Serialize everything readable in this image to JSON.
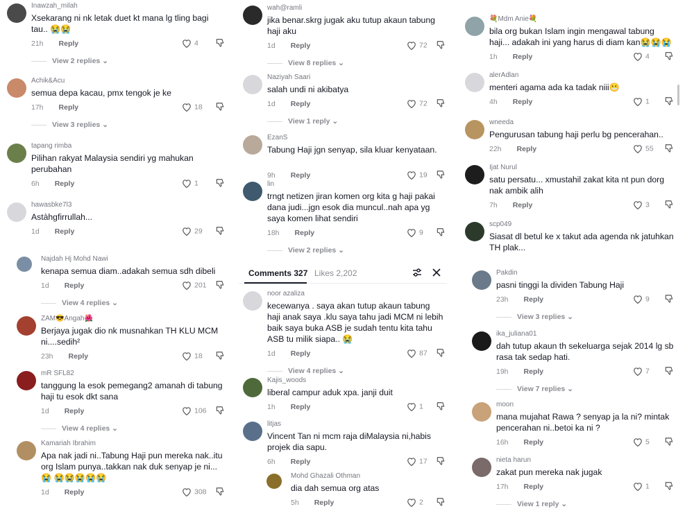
{
  "sheet": {
    "tab_comments": "Comments 327",
    "tab_likes": "Likes 2,202"
  },
  "reply_label": "Reply",
  "colors": {
    "text": "#161823",
    "meta": "#8a8b91",
    "background": "#ffffff"
  },
  "panel1": [
    {
      "user": "Inawzah_milah",
      "text": "Xsekarang ni nk letak duet kt mana lg tling bagi tau.. 😭😭",
      "time": "21h",
      "likes": "4",
      "replies": "View 2 replies",
      "avatar": "#4a4a4a"
    },
    {
      "user": "Achik&Acu",
      "text": "semua depa kacau, pmx tengok je ke",
      "time": "17h",
      "likes": "18",
      "replies": "View 3 replies",
      "avatar": "#c98a6a"
    },
    {
      "user": "tapang rimba",
      "text": "Pilihan rakyat Malaysia sendiri yg mahukan perubahan",
      "time": "6h",
      "likes": "1",
      "replies": "",
      "avatar": "#6b7f4a"
    },
    {
      "user": "hawasbke7l3",
      "text": "Astàhgfirrullah...",
      "time": "1d",
      "likes": "29",
      "replies": "",
      "avatar": "#d8d8dc"
    },
    {
      "user": "Najdah Hj Mohd Nawi",
      "text": "kenapa semua diam..adakah semua sdh dibeli",
      "time": "1d",
      "likes": "201",
      "replies": "View 4 replies",
      "avatar": "#7a8fa5"
    },
    {
      "user": "ZAM😎Angah🌺",
      "text": "Berjaya jugak dio nk musnahkan TH KLU MCM ni....sedih²",
      "time": "23h",
      "likes": "18",
      "replies": "",
      "avatar": "#a3402f"
    },
    {
      "user": "mR SFL82",
      "text": "tanggung la esok pemegang2 amanah di tabung haji tu esok dkt sana",
      "time": "1d",
      "likes": "106",
      "replies": "View 4 replies",
      "avatar": "#8a1e1e"
    },
    {
      "user": "Kamariah Ibrahim",
      "text": "Apa nak jadi ni..Tabung Haji pun mereka nak..itu org Islam punya..takkan nak duk senyap je ni...😭 😭😭😭😭😭",
      "time": "1d",
      "likes": "308",
      "replies": "",
      "avatar": "#b28f63"
    }
  ],
  "panel2": [
    {
      "user": "wah@ramli",
      "text": "jika benar.skrg jugak aku tutup akaun tabung haji aku",
      "time": "1d",
      "likes": "72",
      "replies": "View 8 replies",
      "avatar": "#2a2a2a"
    },
    {
      "user": "Naziyah Saari",
      "text": "salah undi ni akibatya",
      "time": "1d",
      "likes": "72",
      "replies": "View 1 reply",
      "avatar": "#d8d8dc"
    },
    {
      "user": "EzanS",
      "text": "Tabung Haji jgn senyap, sila kluar kenyataan.",
      "time": "9h",
      "likes": "19",
      "replies": "",
      "avatar": "#b9a99a"
    },
    {
      "user": "lin",
      "text": "trngt netizen jiran komen org kita g haji pakai dana judi...jgn esok dia muncul..nah apa yg saya komen lihat sendiri",
      "time": "18h",
      "likes": "9",
      "replies": "View 2 replies",
      "avatar": "#3f5a6e"
    },
    {
      "user": "noor azaliza",
      "text": "kecewanya . saya akan tutup akaun tabung haji anak saya .klu saya tahu jadi MCM ni lebih baik saya buka ASB je sudah tentu kita tahu ASB tu milik siapa.. 😭",
      "time": "1d",
      "likes": "87",
      "replies": "View 4 replies",
      "avatar": "#d8d8dc"
    },
    {
      "user": "Kajis_woods",
      "text": "liberal campur aduk xpa. janji duit",
      "time": "1h",
      "likes": "1",
      "replies": "",
      "avatar": "#4f6a3a"
    },
    {
      "user": "litjas",
      "text": "Vincent Tan ni mcm raja diMalaysia ni,habis projek dia sapu.",
      "time": "6h",
      "likes": "17",
      "replies": "",
      "avatar": "#5a6f8a"
    },
    {
      "user": "Mohd Ghazali Othman",
      "text": "dia dah semua org atas",
      "time": "5h",
      "likes": "2",
      "replies": "",
      "avatar": "#8a6f2a"
    }
  ],
  "panel3": [
    {
      "user": "💐Mdm Anie💐",
      "text": "bila org bukan Islam ingin mengawal tabung haji... adakah ini yang harus di diam kan😭😭😭",
      "time": "1h",
      "likes": "4",
      "replies": "",
      "avatar": "#8fa3a8"
    },
    {
      "user": "alerAdlan",
      "text": "menteri agama ada ka tadak niii😬",
      "time": "4h",
      "likes": "1",
      "replies": "",
      "avatar": "#d8d8dc"
    },
    {
      "user": "wneeda",
      "text": "Pengurusan tabung haji perlu bg pencerahan..",
      "time": "22h",
      "likes": "55",
      "replies": "",
      "avatar": "#b89460"
    },
    {
      "user": "Ijat Nurul",
      "text": "satu persatu... xmustahil zakat kita nt pun dorg nak ambik alih",
      "time": "7h",
      "likes": "3",
      "replies": "",
      "avatar": "#1d1d1d"
    },
    {
      "user": "scp049",
      "text": "Siasat dl betul ke x takut ada agenda nk jatuhkan TH plak...",
      "time": "",
      "likes": "",
      "replies": "",
      "avatar": "#2c3a2c"
    },
    {
      "user": "Pakdin",
      "text": "pasni tinggi la dividen Tabung Haji",
      "time": "23h",
      "likes": "9",
      "replies": "View 3 replies",
      "avatar": "#6a7a8a"
    },
    {
      "user": "ika_juliana01",
      "text": "dah tutup akaun th sekeluarga sejak 2014 lg sb rasa tak sedap hati.",
      "time": "19h",
      "likes": "7",
      "replies": "View 7 replies",
      "avatar": "#1a1a1a"
    },
    {
      "user": "moon",
      "text": "mana mujahat Rawa ? senyap ja la ni? mintak pencerahan ni..betoi ka ni ?",
      "time": "16h",
      "likes": "5",
      "replies": "",
      "avatar": "#c9a27a"
    },
    {
      "user": "nieta harun",
      "text": "zakat pun mereka nak jugak",
      "time": "17h",
      "likes": "1",
      "replies": "View 1 reply",
      "avatar": "#7a6a6a"
    }
  ]
}
